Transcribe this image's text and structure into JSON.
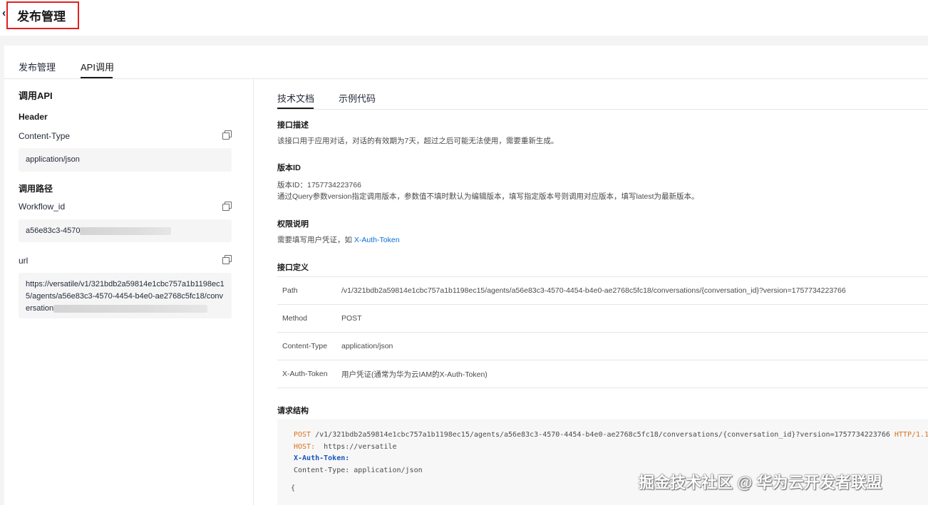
{
  "header": {
    "back_icon": "chevron-left-icon",
    "title": "发布管理"
  },
  "main_tabs": [
    {
      "label": "发布管理",
      "active": false
    },
    {
      "label": "API调用",
      "active": true
    }
  ],
  "left": {
    "title": "调用API",
    "header_section": "Header",
    "content_type_label": "Content-Type",
    "content_type_value": "application/json",
    "path_section": "调用路径",
    "workflow_label": "Workflow_id",
    "workflow_value": "a56e83c3-4570",
    "url_label": "url",
    "url_value_lines": [
      "https://versatile/v1/321bdb2a59814e1cbc757a1b1198ec1",
      "5/agents/a56e83c3-4570-4454-b4e0-ae2768c5fc18/conv",
      "ersation"
    ]
  },
  "sub_tabs": [
    {
      "label": "技术文档",
      "active": true
    },
    {
      "label": "示例代码",
      "active": false
    }
  ],
  "doc": {
    "desc_title": "接口描述",
    "desc_text": "该接口用于应用对话，对话的有效期为7天，超过之后可能无法使用，需要重新生成。",
    "version_title": "版本ID",
    "version_line1": "版本ID：1757734223766",
    "version_line2": "通过Query参数version指定调用版本，参数值不填时默认为编辑版本，填写指定版本号则调用对应版本，填写latest为最新版本。",
    "auth_title": "权限说明",
    "auth_text": "需要填写用户凭证，如",
    "auth_link": "X-Auth-Token",
    "def_title": "接口定义",
    "def_rows": [
      {
        "key": "Path",
        "value": "/v1/321bdb2a59814e1cbc757a1b1198ec15/agents/a56e83c3-4570-4454-b4e0-ae2768c5fc18/conversations/{conversation_id}?version=1757734223766"
      },
      {
        "key": "Method",
        "value": "POST"
      },
      {
        "key": "Content-Type",
        "value": "application/json"
      },
      {
        "key": "X-Auth-Token",
        "value": "用户凭证(通常为华为云IAM的X-Auth-Token)"
      }
    ],
    "req_title": "请求结构",
    "code": {
      "method": "POST",
      "path": " /v1/321bdb2a59814e1cbc757a1b1198ec15/agents/a56e83c3-4570-4454-b4e0-ae2768c5fc18/conversations/{conversation_id}?version=1757734223766 ",
      "proto": "HTTP/1.1",
      "host_key": "HOST:",
      "host_val": "  https://versatile",
      "token_key": "X-Auth-Token:",
      "ct_line": "Content-Type: application/json",
      "brace": "{"
    }
  },
  "watermark": "掘金技术社区 @ 华为云开发者联盟",
  "colors": {
    "accent": "#191919",
    "link": "#0a6fd8",
    "highlight_border": "#e02020",
    "code_keyword": "#d9731a"
  }
}
